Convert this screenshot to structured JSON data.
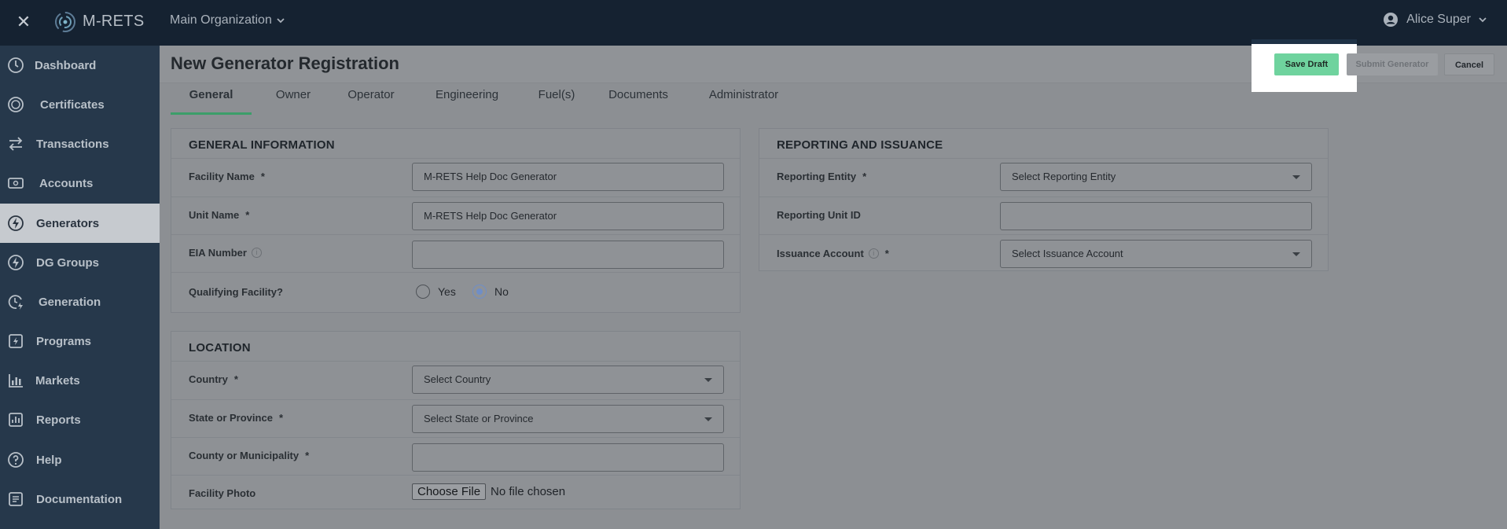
{
  "app": {
    "brand": "M-RETS",
    "organization": "Main Organization",
    "user": "Alice Super"
  },
  "sidebar": {
    "items": [
      {
        "label": "Dashboard",
        "icon": "dashboard-icon"
      },
      {
        "label": "Certificates",
        "icon": "certificate-icon"
      },
      {
        "label": "Transactions",
        "icon": "transfer-icon"
      },
      {
        "label": "Accounts",
        "icon": "account-icon"
      },
      {
        "label": "Generators",
        "icon": "lightning-icon",
        "active": true
      },
      {
        "label": "DG Groups",
        "icon": "lightning-circle-icon"
      },
      {
        "label": "Generation",
        "icon": "clock-lightning-icon"
      },
      {
        "label": "Programs",
        "icon": "programs-icon"
      },
      {
        "label": "Markets",
        "icon": "bar-chart-icon"
      },
      {
        "label": "Reports",
        "icon": "report-icon"
      },
      {
        "label": "Help",
        "icon": "help-icon"
      },
      {
        "label": "Documentation",
        "icon": "document-icon"
      }
    ]
  },
  "header": {
    "title": "New Generator Registration",
    "save_label": "Save Draft",
    "submit_label": "Submit Generator",
    "cancel_label": "Cancel"
  },
  "tabs": [
    "General",
    "Owner",
    "Operator",
    "Engineering",
    "Fuel(s)",
    "Documents",
    "Administrator"
  ],
  "general_info": {
    "title": "GENERAL INFORMATION",
    "facility_name_label": "Facility Name",
    "facility_name_value": "M-RETS Help Doc Generator",
    "unit_name_label": "Unit Name",
    "unit_name_value": "M-RETS Help Doc Generator",
    "eia_label": "EIA Number",
    "eia_value": "",
    "qualifying_label": "Qualifying Facility?",
    "yes_label": "Yes",
    "no_label": "No",
    "selected": "No"
  },
  "location": {
    "title": "LOCATION",
    "country_label": "Country",
    "country_value": "Select Country",
    "state_label": "State or Province",
    "state_value": "Select State or Province",
    "county_label": "County or Municipality",
    "county_value": "",
    "photo_label": "Facility Photo",
    "choose_file": "Choose File",
    "no_file": "No file chosen"
  },
  "reporting": {
    "title": "REPORTING AND ISSUANCE",
    "entity_label": "Reporting Entity",
    "entity_value": "Select Reporting Entity",
    "unit_id_label": "Reporting Unit ID",
    "unit_id_value": "",
    "issuance_label": "Issuance Account",
    "issuance_value": "Select Issuance Account"
  },
  "required_mark": "*",
  "info_mark": "i",
  "close_glyph": "✕"
}
